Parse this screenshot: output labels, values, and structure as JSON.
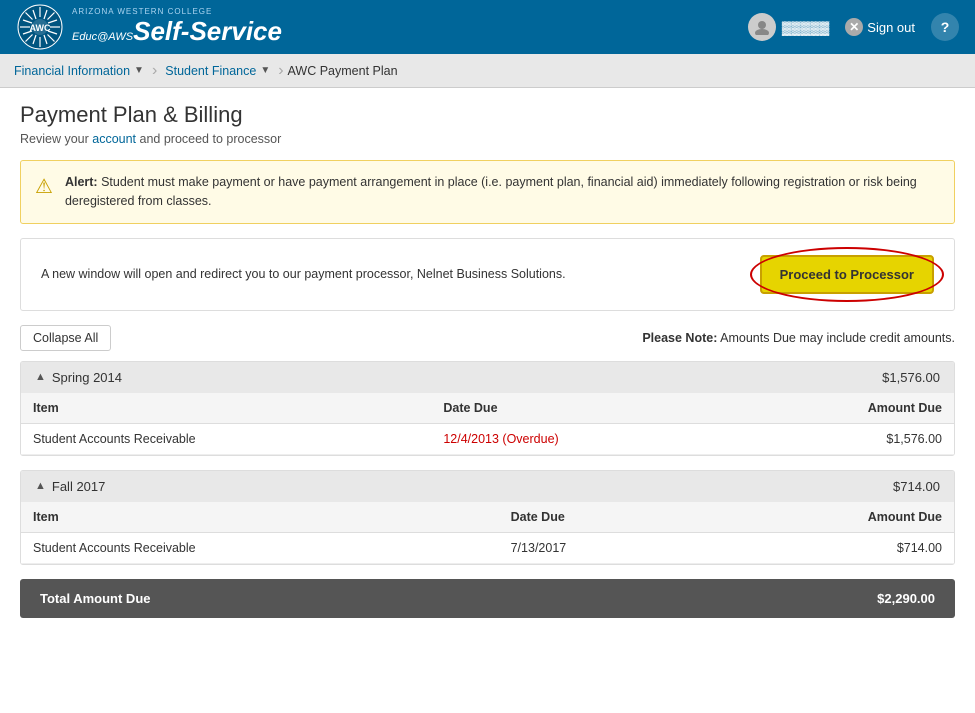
{
  "header": {
    "logo_line1": "Educ@AWS",
    "logo_line2": "Self-Service",
    "school_name": "ARIZONA WESTERN COLLEGE",
    "user_name": "▓▓▓▓▓",
    "sign_out_label": "Sign out",
    "help_label": "He"
  },
  "nav": {
    "item1": "Financial Information",
    "item2": "Student Finance",
    "current": "AWC Payment Plan"
  },
  "page": {
    "title": "Payment Plan & Billing",
    "subtitle_pre": "Review your ",
    "subtitle_link": "account",
    "subtitle_post": " and proceed to processor"
  },
  "alert": {
    "text": "Alert: Student must make payment or have payment arrangement in place (i.e. payment plan, financial aid) immediately following registration or risk being deregistered from classes."
  },
  "processor": {
    "text": "A new window will open and redirect you to our payment processor, Nelnet Business Solutions.",
    "button_label": "Proceed to Processor"
  },
  "toolbar": {
    "collapse_label": "Collapse All",
    "note": "Please Note:",
    "note_text": " Amounts Due may include credit amounts."
  },
  "terms": [
    {
      "name": "Spring 2014",
      "amount": "$1,576.00",
      "columns": [
        "Item",
        "Date Due",
        "Amount Due"
      ],
      "rows": [
        {
          "item": "Student Accounts Receivable",
          "date_due": "12/4/2013 (Overdue)",
          "amount": "$1,576.00",
          "overdue": true
        }
      ]
    },
    {
      "name": "Fall 2017",
      "amount": "$714.00",
      "columns": [
        "Item",
        "Date Due",
        "Amount Due"
      ],
      "rows": [
        {
          "item": "Student Accounts Receivable",
          "date_due": "7/13/2017",
          "amount": "$714.00",
          "overdue": false
        }
      ]
    }
  ],
  "total": {
    "label": "Total Amount Due",
    "amount": "$2,290.00"
  }
}
